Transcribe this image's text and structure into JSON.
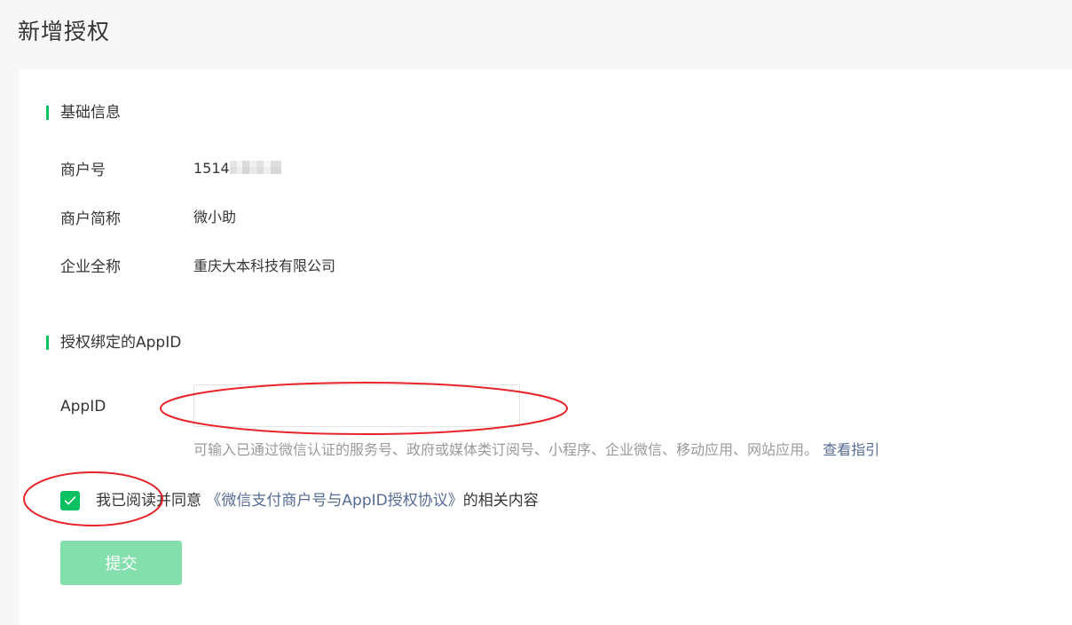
{
  "page": {
    "title": "新增授权"
  },
  "basic_info": {
    "section_title": "基础信息",
    "fields": [
      {
        "label": "商户号",
        "value": "1514"
      },
      {
        "label": "商户简称",
        "value": "微小助"
      },
      {
        "label": "企业全称",
        "value": "重庆大本科技有限公司"
      }
    ]
  },
  "appid_section": {
    "section_title": "授权绑定的AppID",
    "label": "AppID",
    "input_value": "",
    "hint": "可输入已通过微信认证的服务号、政府或媒体类订阅号、小程序、企业微信、移动应用、网站应用。",
    "guide_link": "查看指引"
  },
  "agreement": {
    "checked": true,
    "prefix": "我已阅读并同意",
    "link": "《微信支付商户号与AppID授权协议》",
    "suffix": "的相关内容"
  },
  "submit_label": "提交",
  "colors": {
    "brand": "#07c160",
    "link": "#576b95",
    "disabled_button": "#83e0ac",
    "annotation": "#e8232a"
  },
  "icons": {
    "checkbox": "checkmark-icon"
  }
}
